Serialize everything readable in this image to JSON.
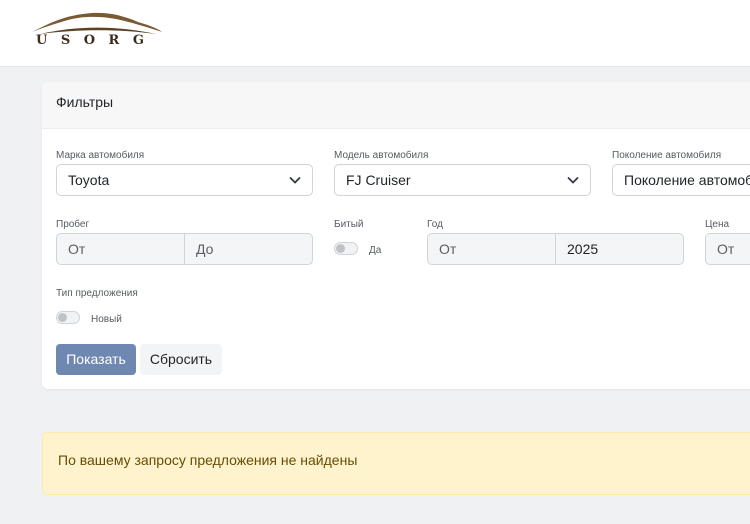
{
  "logo": {
    "text": "USORG",
    "icon": "car-silhouette-logo"
  },
  "filters": {
    "title": "Фильтры",
    "brand": {
      "label": "Марка автомобиля",
      "value": "Toyota"
    },
    "model": {
      "label": "Модель автомобиля",
      "value": "FJ Cruiser"
    },
    "generation": {
      "label": "Поколение автомобиля",
      "value": "Поколение автомоби"
    },
    "mileage": {
      "label": "Пробег",
      "from_placeholder": "От",
      "to_placeholder": "До"
    },
    "damaged": {
      "label": "Битый",
      "toggle_label": "Да"
    },
    "year": {
      "label": "Год",
      "from_placeholder": "От",
      "to_value": "2025"
    },
    "price": {
      "label": "Цена",
      "from_placeholder": "От"
    },
    "offer_type": {
      "label": "Тип предложения",
      "toggle_label": "Новый"
    },
    "show_label": "Показать",
    "reset_label": "Сбросить"
  },
  "alert": {
    "message": "По вашему запросу предложения не найдены"
  },
  "colors": {
    "primary_button": "#6f88b2",
    "alert_bg": "#fff3cd",
    "alert_text": "#664d03",
    "logo": "#7a5a33"
  }
}
